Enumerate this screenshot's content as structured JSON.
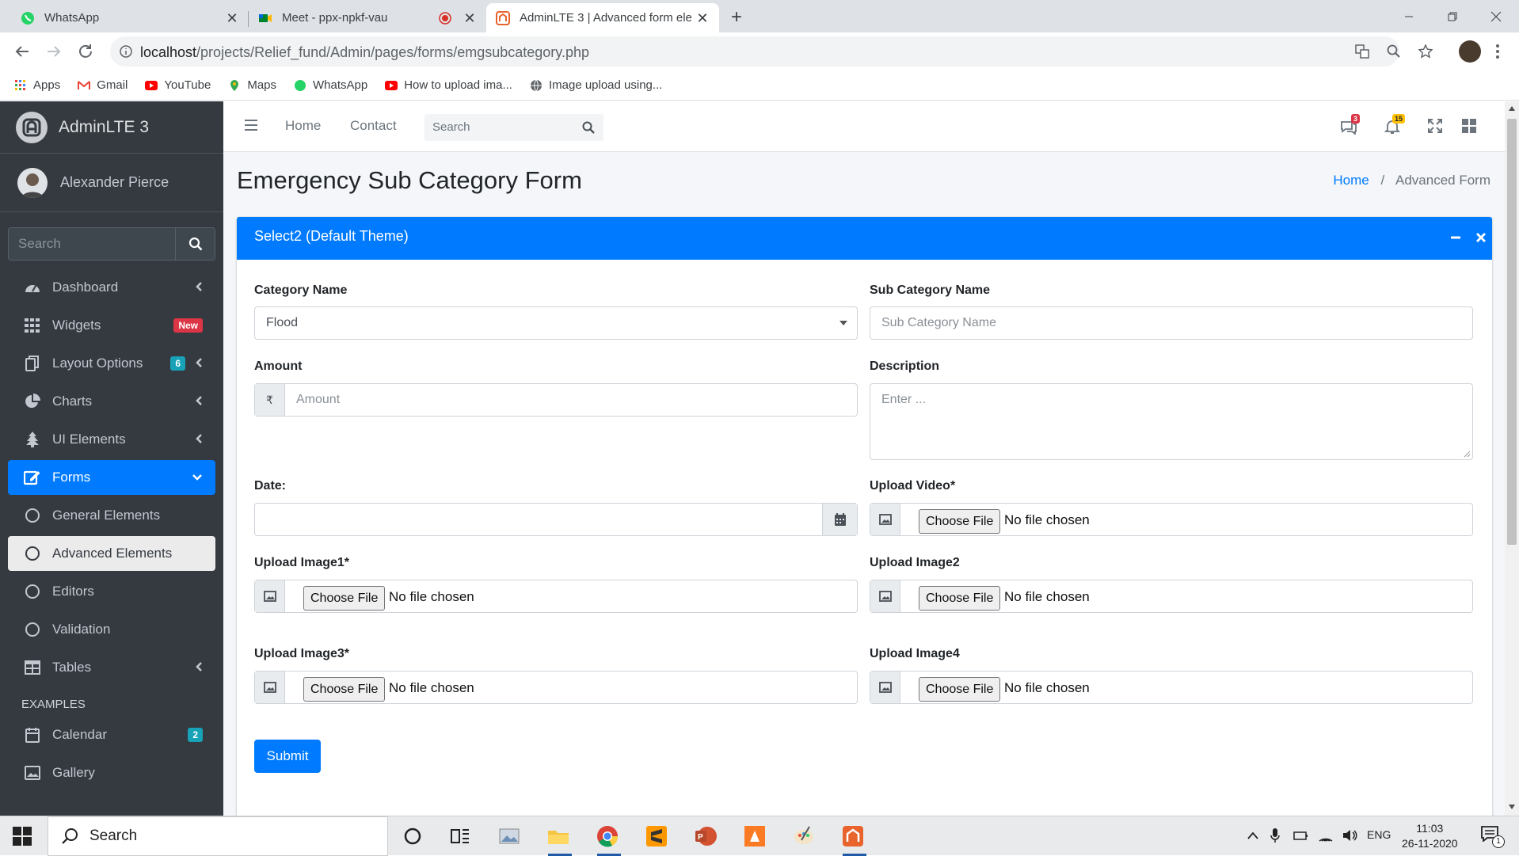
{
  "browser": {
    "tabs": [
      {
        "title": "WhatsApp",
        "favicon": "whatsapp-icon"
      },
      {
        "title": "Meet - ppx-npkf-vau",
        "favicon": "google-meet-icon"
      },
      {
        "title": "AdminLTE 3 | Advanced form ele",
        "favicon": "adminlte-icon"
      }
    ],
    "url_host": "localhost",
    "url_path": "/projects/Relief_fund/Admin/pages/forms/emgsubcategory.php",
    "bookmarks": [
      "Apps",
      "Gmail",
      "YouTube",
      "Maps",
      "WhatsApp",
      "How to upload ima...",
      "Image upload using..."
    ]
  },
  "sidebar": {
    "brand": "AdminLTE 3",
    "user": "Alexander Pierce",
    "search_placeholder": "Search",
    "items": [
      {
        "label": "Dashboard"
      },
      {
        "label": "Widgets",
        "badge": "New"
      },
      {
        "label": "Layout Options",
        "badge": "6"
      },
      {
        "label": "Charts"
      },
      {
        "label": "UI Elements"
      },
      {
        "label": "Forms"
      },
      {
        "label": "General Elements"
      },
      {
        "label": "Advanced Elements"
      },
      {
        "label": "Editors"
      },
      {
        "label": "Validation"
      },
      {
        "label": "Tables"
      }
    ],
    "header_examples": "EXAMPLES",
    "examples": [
      {
        "label": "Calendar",
        "badge": "2"
      },
      {
        "label": "Gallery"
      }
    ]
  },
  "topnav": {
    "home": "Home",
    "contact": "Contact",
    "search_placeholder": "Search",
    "messages_count": "3",
    "notifications_count": "15"
  },
  "page": {
    "title": "Emergency Sub Category Form",
    "breadcrumb_home": "Home",
    "breadcrumb_current": "Advanced Form"
  },
  "card": {
    "title": "Select2 (Default Theme)",
    "category_label": "Category Name",
    "category_value": "Flood",
    "subcategory_label": "Sub Category Name",
    "subcategory_placeholder": "Sub Category Name",
    "amount_label": "Amount",
    "amount_prefix": "₹",
    "amount_placeholder": "Amount",
    "description_label": "Description",
    "description_placeholder": "Enter ...",
    "date_label": "Date:",
    "upload_video_label": "Upload Video*",
    "upload_image1_label": "Upload Image1*",
    "upload_image2_label": "Upload Image2",
    "upload_image3_label": "Upload Image3*",
    "upload_image4_label": "Upload Image4",
    "choose_file": "Choose File",
    "no_file": "No file chosen",
    "submit": "Submit"
  },
  "taskbar": {
    "search": "Search",
    "lang": "ENG",
    "time": "11:03",
    "date": "26-11-2020",
    "notification_count": "1"
  },
  "colors": {
    "primary": "#007bff",
    "sidebar_bg": "#343a40"
  }
}
